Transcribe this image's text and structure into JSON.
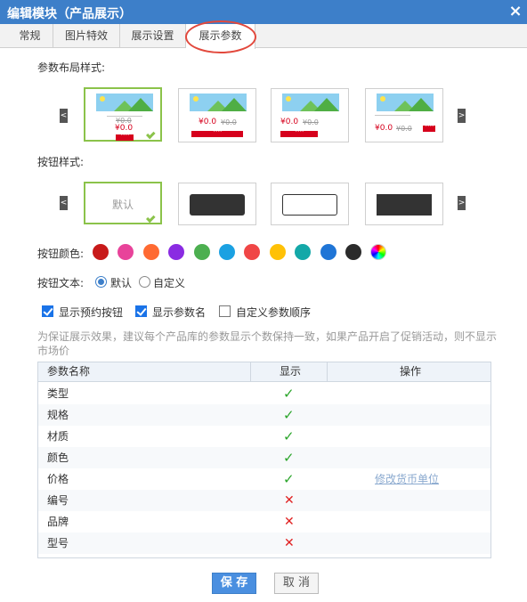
{
  "dialog": {
    "title": "编辑模块（产品展示）",
    "close_icon": "×"
  },
  "tabs": [
    {
      "label": "常规"
    },
    {
      "label": "图片特效"
    },
    {
      "label": "展示设置"
    },
    {
      "label": "展示参数"
    }
  ],
  "layout_style": {
    "label": "参数布局样式:",
    "prev": "<",
    "next": ">",
    "thumbs": [
      {
        "price": "¥0.0",
        "old_price": "¥0.0"
      },
      {
        "price": "¥0.0",
        "old_price": "¥0.0"
      },
      {
        "price": "¥0.0",
        "old_price": "¥0.0"
      },
      {
        "price": "¥0.0",
        "old_price": "¥0.0"
      }
    ]
  },
  "button_style": {
    "label": "按钮样式:",
    "default_text": "默认",
    "prev": "<",
    "next": ">"
  },
  "button_color": {
    "label": "按钮颜色:",
    "colors": [
      "#c81a1a",
      "#e8439a",
      "#ff6a32",
      "#8a2be2",
      "#4caf50",
      "#1ba1e2",
      "#f04646",
      "#ffc107",
      "#14a8a8",
      "#1f75d6",
      "#2b2b2b",
      "rainbow"
    ]
  },
  "button_text": {
    "label": "按钮文本:",
    "options": [
      "默认",
      "自定义"
    ]
  },
  "checkboxes": [
    {
      "label": "显示预约按钮",
      "checked": true
    },
    {
      "label": "显示参数名",
      "checked": true
    },
    {
      "label": "自定义参数顺序",
      "checked": false
    }
  ],
  "note": "为保证展示效果，建议每个产品库的参数显示个数保持一致，如果产品开启了促销活动，则不显示市场价",
  "table": {
    "headers": [
      "参数名称",
      "显示",
      "操作"
    ],
    "rows": [
      {
        "name": "类型",
        "shown": true
      },
      {
        "name": "规格",
        "shown": true
      },
      {
        "name": "材质",
        "shown": true
      },
      {
        "name": "颜色",
        "shown": true
      },
      {
        "name": "价格",
        "shown": true,
        "action": "修改货币单位"
      },
      {
        "name": "编号",
        "shown": false
      },
      {
        "name": "品牌",
        "shown": false
      },
      {
        "name": "型号",
        "shown": false
      }
    ],
    "ok_icon": "✓",
    "no_icon": "✕"
  },
  "footer": {
    "save": "保 存",
    "cancel": "取 消"
  }
}
